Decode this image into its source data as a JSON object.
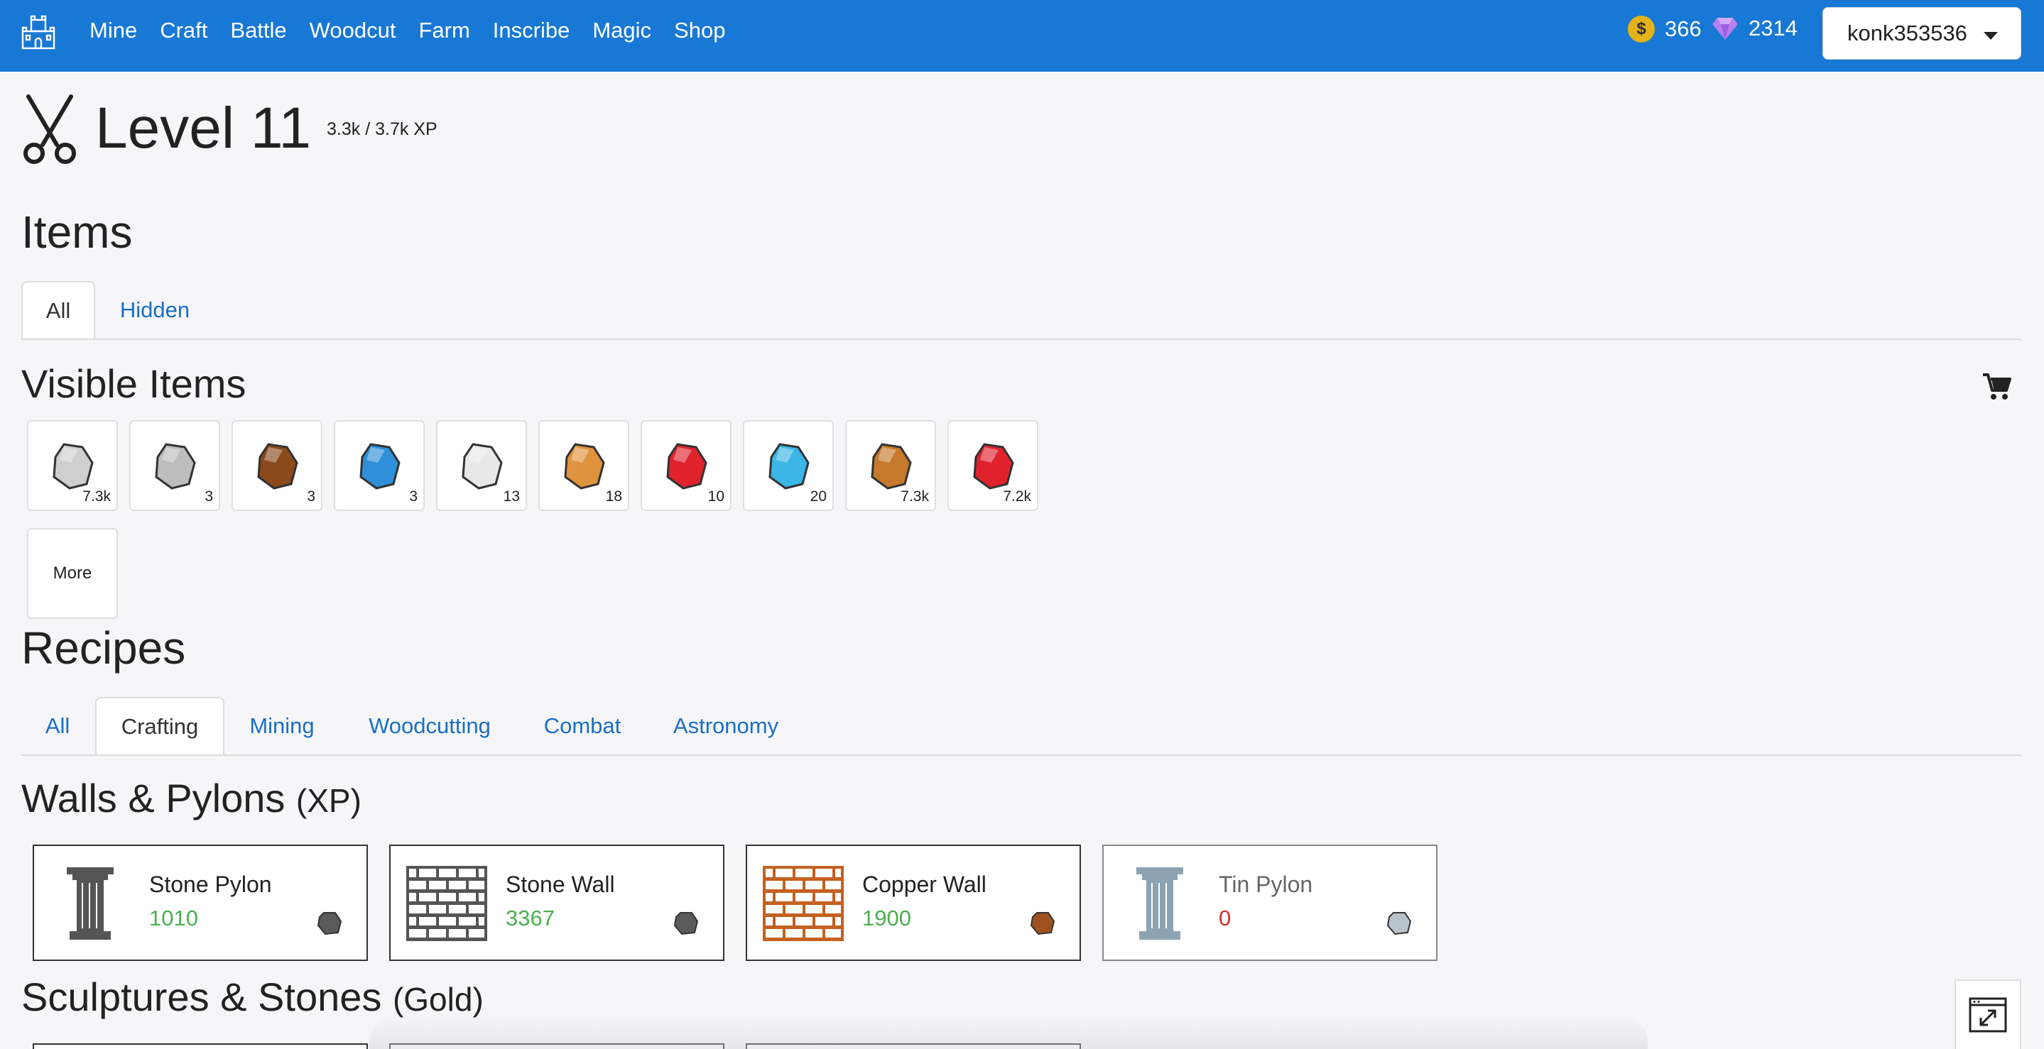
{
  "nav": {
    "links": [
      "Mine",
      "Craft",
      "Battle",
      "Woodcut",
      "Farm",
      "Inscribe",
      "Magic",
      "Shop"
    ],
    "gold": "366",
    "gems": "2314",
    "username": "konk353536",
    "coin_symbol": "$"
  },
  "level": {
    "title": "Level 11",
    "xp": "3.3k / 3.7k XP"
  },
  "items": {
    "heading": "Items",
    "tabs": [
      "All",
      "Hidden"
    ],
    "active_tab": "All",
    "visible_heading": "Visible Items",
    "list": [
      {
        "name": "stone",
        "count": "7.3k",
        "color": "#cfcfcf"
      },
      {
        "name": "tin-ore",
        "count": "3",
        "color": "#bdbdbd"
      },
      {
        "name": "copper-ore",
        "count": "3",
        "color": "#8a4a1c"
      },
      {
        "name": "sapphire-ore",
        "count": "3",
        "color": "#2f8fd8"
      },
      {
        "name": "quartz",
        "count": "13",
        "color": "#e8e8e8"
      },
      {
        "name": "amber",
        "count": "18",
        "color": "#e0933d"
      },
      {
        "name": "ruby",
        "count": "10",
        "color": "#e0222d"
      },
      {
        "name": "sapphire",
        "count": "20",
        "color": "#3bb6e6"
      },
      {
        "name": "copper",
        "count": "7.3k",
        "color": "#c77a2c"
      },
      {
        "name": "garnet",
        "count": "7.2k",
        "color": "#e0222d"
      }
    ],
    "more_label": "More"
  },
  "recipes": {
    "heading": "Recipes",
    "tabs": [
      "All",
      "Crafting",
      "Mining",
      "Woodcutting",
      "Combat",
      "Astronomy"
    ],
    "active_tab": "Crafting",
    "section1_title": "Walls & Pylons",
    "section1_sub": "(XP)",
    "section2_title": "Sculptures & Stones",
    "section2_sub": "(Gold)",
    "cards": [
      {
        "name": "Stone Pylon",
        "value": "1010",
        "value_color": "#4caf50",
        "kind": "pylon",
        "color": "#555555"
      },
      {
        "name": "Stone Wall",
        "value": "3367",
        "value_color": "#4caf50",
        "kind": "wall",
        "color": "#555555"
      },
      {
        "name": "Copper Wall",
        "value": "1900",
        "value_color": "#4caf50",
        "kind": "wall",
        "color": "#c4601f"
      },
      {
        "name": "Tin Pylon",
        "value": "0",
        "value_color": "#d32f2f",
        "kind": "pylon",
        "color": "#8ea3b2"
      }
    ]
  },
  "colors": {
    "nav_bg": "#1878d6",
    "link": "#1a6fc4",
    "positive": "#4caf50",
    "negative": "#d32f2f"
  }
}
